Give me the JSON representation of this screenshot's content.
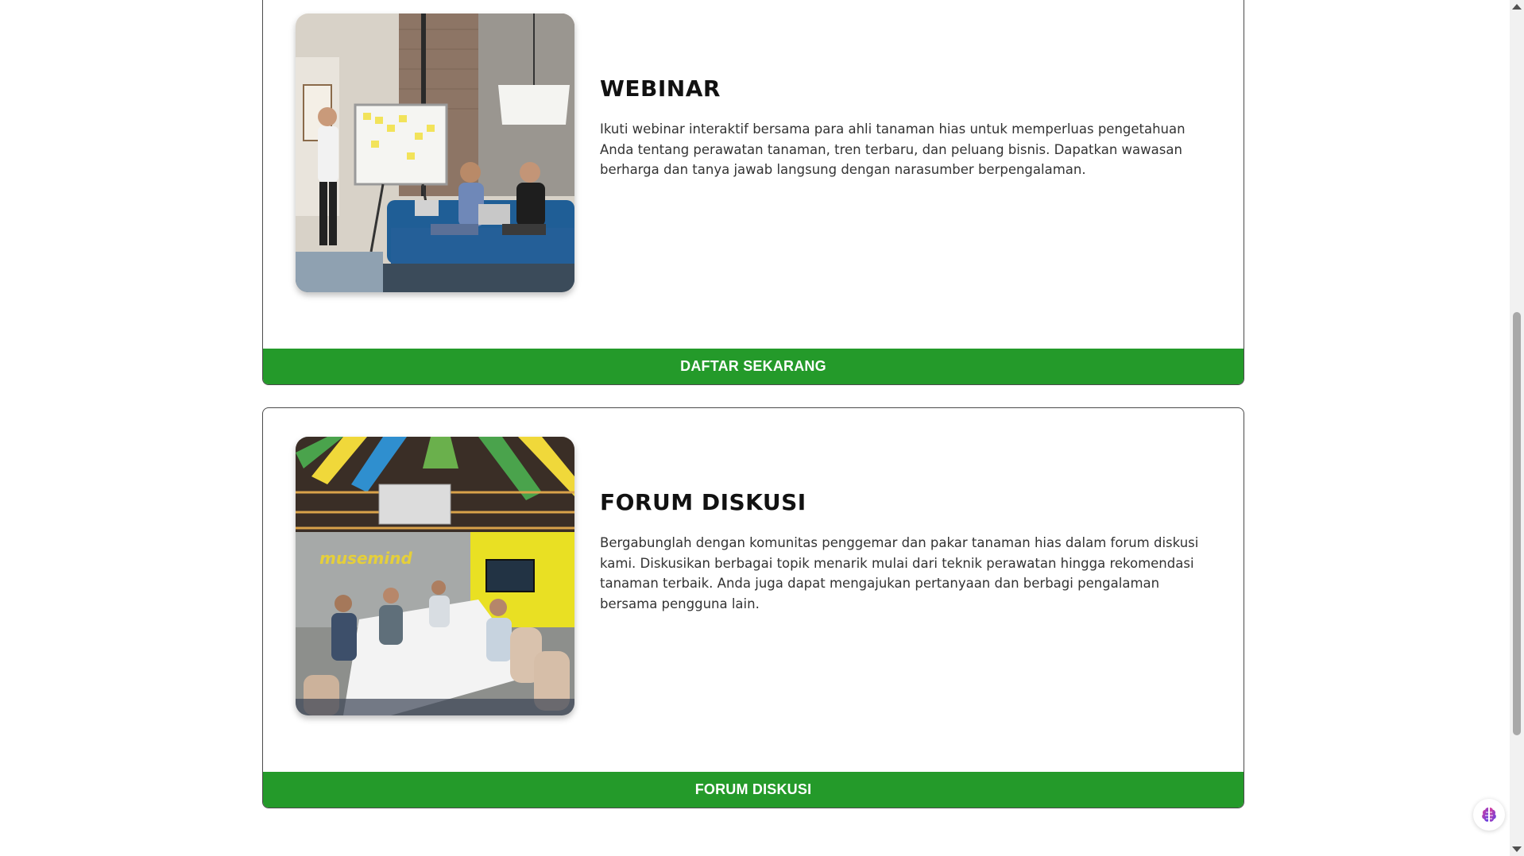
{
  "cards": [
    {
      "title": "WEBINAR",
      "description": "Ikuti webinar interaktif bersama para ahli tanaman hias untuk memperluas pengetahuan Anda tentang perawatan tanaman, tren terbaru, dan peluang bisnis. Dapatkan wawasan berharga dan tanya jawab langsung dengan narasumber berpengalaman.",
      "button_label": "DAFTAR SEKARANG"
    },
    {
      "title": "FORUM DISKUSI",
      "description": "Bergabunglah dengan komunitas penggemar dan pakar tanaman hias dalam forum diskusi kami. Diskusikan berbagai topik menarik mulai dari teknik perawatan hingga rekomendasi tanaman terbaik. Anda juga dapat mengajukan pertanyaan dan berbagi pengalaman bersama pengguna lain.",
      "button_label": "FORUM DISKUSI",
      "photo_wall_text": "musemind"
    }
  ],
  "colors": {
    "accent_green": "#249a2a",
    "card_border": "#4a4a4a"
  }
}
